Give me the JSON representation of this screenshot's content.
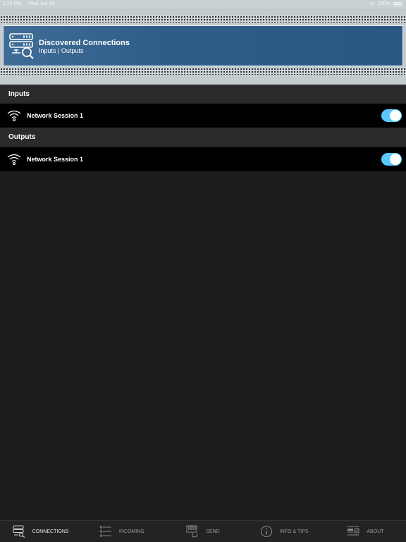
{
  "status_bar": {
    "time": "3:26 PM",
    "date": "Wed Jun 24",
    "battery": "100%"
  },
  "banner": {
    "title": "Discovered Connections",
    "subtitle": "Inputs | Outputs"
  },
  "sections": [
    {
      "header": "Inputs",
      "rows": [
        {
          "label": "Network Session 1",
          "enabled": true
        }
      ]
    },
    {
      "header": "Outputs",
      "rows": [
        {
          "label": "Network Session 1",
          "enabled": true
        }
      ]
    }
  ],
  "tabs": [
    {
      "label": "CONNECTIONS",
      "icon": "connections-icon",
      "active": true
    },
    {
      "label": "INCOMING",
      "icon": "list-icon",
      "active": false
    },
    {
      "label": "SEND",
      "icon": "keyboard-icon",
      "active": false
    },
    {
      "label": "INFO & TIPS",
      "icon": "info-icon",
      "active": false
    },
    {
      "label": "ABOUT",
      "icon": "about-icon",
      "active": false
    }
  ],
  "colors": {
    "toggle_on": "#5ac8fa",
    "banner": "#2f5d89"
  }
}
